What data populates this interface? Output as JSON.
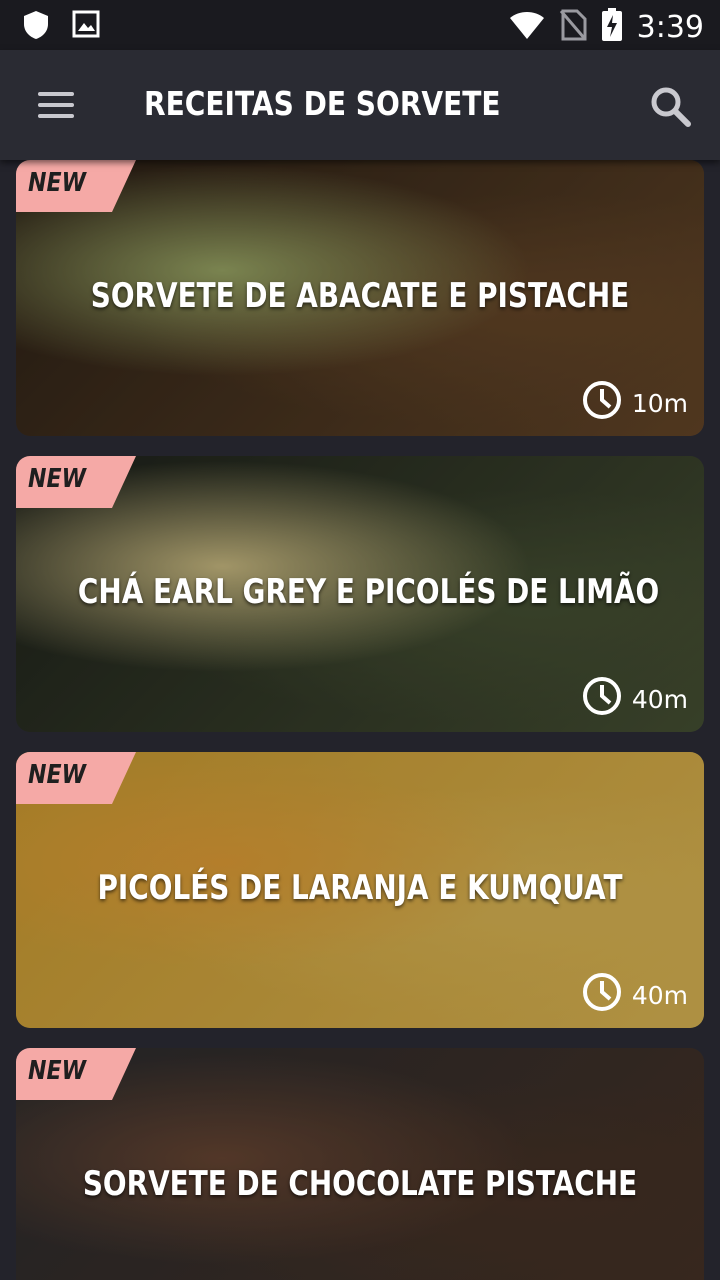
{
  "status_bar": {
    "time": "3:39",
    "icons": [
      "shield-icon",
      "image-icon",
      "wifi-icon",
      "no-sim-icon",
      "battery-charging-icon"
    ]
  },
  "app_bar": {
    "title": "RECEITAS DE SORVETE",
    "menu_icon": "menu-icon",
    "search_icon": "search-icon"
  },
  "recipes": [
    {
      "badge": "NEW",
      "name": "SORVETE DE ABACATE E PISTACHE",
      "time": "10m",
      "colors": [
        "#2b2117",
        "#6b4a2a",
        "#a3b06b"
      ]
    },
    {
      "badge": "NEW",
      "name": "CHÁ EARL GREY E PICOLÉS DE LIMÃO",
      "time": "40m",
      "colors": [
        "#1f221c",
        "#4a5536",
        "#d7c78a"
      ]
    },
    {
      "badge": "NEW",
      "name": "PICOLÉS DE LARANJA E KUMQUAT",
      "time": "40m",
      "colors": [
        "#d9a432",
        "#e9c25a",
        "#f0a93a"
      ]
    },
    {
      "badge": "NEW",
      "name": "SORVETE DE CHOCOLATE PISTACHE",
      "time": "",
      "colors": [
        "#2f2f31",
        "#4b3528",
        "#6e4a36"
      ]
    }
  ],
  "colors": {
    "badge_bg": "#f5a9a6",
    "app_bar_bg": "#2a2b33",
    "background": "#23232b"
  }
}
